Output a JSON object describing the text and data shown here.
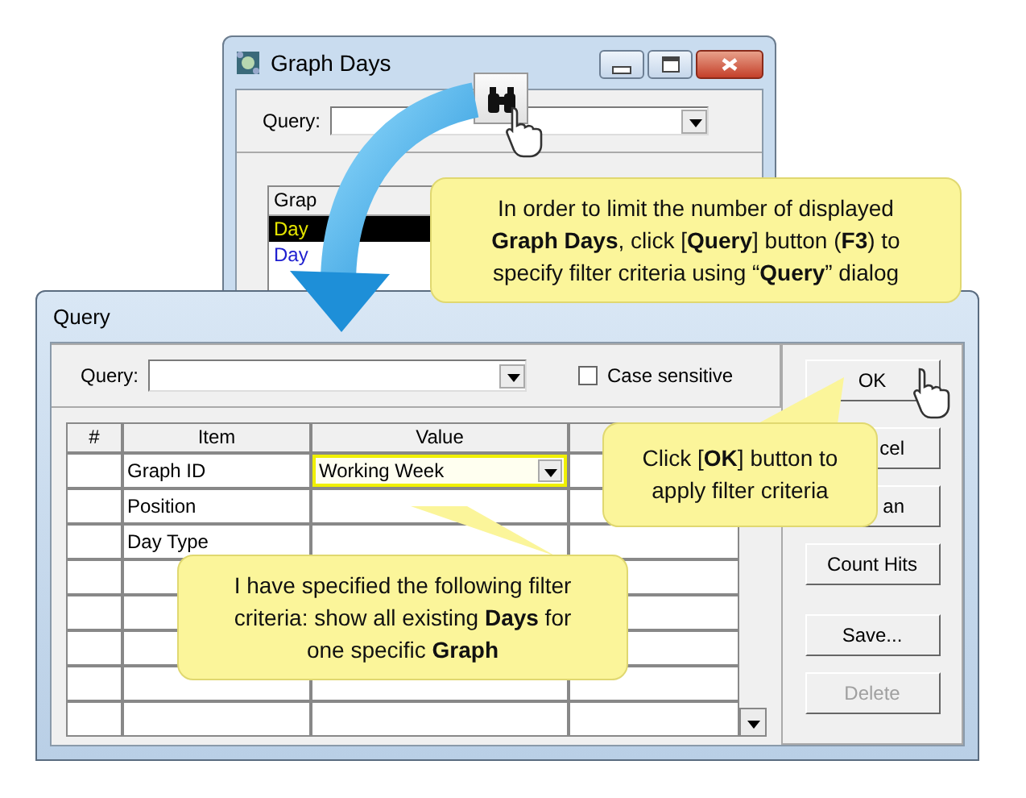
{
  "graph_days_window": {
    "title": "Graph Days",
    "query_label": "Query:",
    "list_header": "Grap",
    "list_rows": [
      {
        "text": "Day",
        "selected": true,
        "color": "#e6e600"
      },
      {
        "text": "Day",
        "selected": false,
        "color": "#2020d0"
      }
    ]
  },
  "query_window": {
    "title": "Query",
    "query_label": "Query:",
    "case_sensitive": {
      "label": "Case sensitive",
      "checked": false
    },
    "columns": [
      "#",
      "Item",
      "Value"
    ],
    "rows": [
      {
        "item": "Graph ID",
        "value": "Working Week",
        "highlighted": true
      },
      {
        "item": "Position",
        "highlighted": false
      },
      {
        "item": "Day Type",
        "highlighted": false
      }
    ],
    "buttons": [
      {
        "label": "OK",
        "kind": "full",
        "disabled": false
      },
      {
        "label": "cel",
        "kind": "partial",
        "disabled": false
      },
      {
        "label": "an",
        "kind": "partial",
        "disabled": false
      },
      {
        "label": "Count Hits",
        "kind": "full",
        "disabled": false
      },
      {
        "label": "Save...",
        "kind": "full",
        "disabled": false
      },
      {
        "label": "Delete",
        "kind": "full",
        "disabled": true
      }
    ]
  },
  "callouts": [
    {
      "kind": "top",
      "text": "In order to limit the number of displayed **Graph Days**, click [**Query**] button (**F3**) to specify filter criteria using “**Query**” dialog"
    },
    {
      "kind": "bottom",
      "text": "I have specified the following filter criteria: show all existing **Days** for one specific **Graph**"
    },
    {
      "kind": "right",
      "text": "Click [**OK**] button to apply filter criteria"
    }
  ]
}
